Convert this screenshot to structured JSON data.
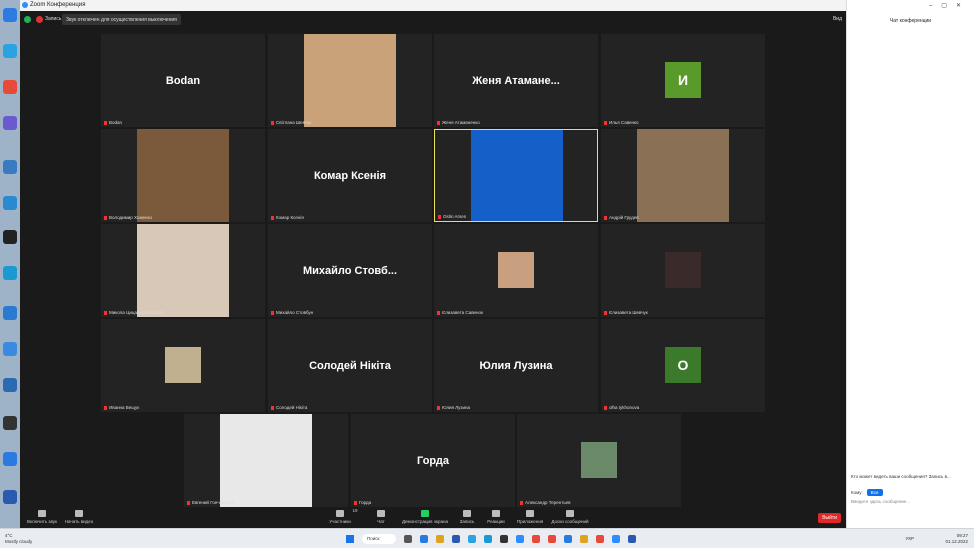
{
  "window": {
    "title": "Zoom Конференция"
  },
  "topbar": {
    "recording": "Запись",
    "tooltip": "Звук отключен для осуществления выключения",
    "view": "Вид"
  },
  "tiles": [
    {
      "name": "Bodan",
      "label": "Bodan",
      "kind": "text"
    },
    {
      "name": "Svitlana Shevchuk",
      "label": "Світлана Шевчук",
      "kind": "photo",
      "color": "#c9a27a"
    },
    {
      "name": "Женя Атамане...",
      "label": "Женя Атаманенко",
      "kind": "text"
    },
    {
      "name": "Ilya Savchenko",
      "label": "Илья Савенко",
      "kind": "avatar",
      "letter": "И",
      "color": "#5a9a2a"
    },
    {
      "name": "Volodymyr",
      "label": "Володимир Хоменко",
      "kind": "photo",
      "color": "#7a5a3a"
    },
    {
      "name": "Комар Ксенія",
      "label": "Комар Ксенія",
      "kind": "text"
    },
    {
      "name": "Ostin Arsen",
      "label": "Ostin Arsen",
      "kind": "blue",
      "color": "#1560c8"
    },
    {
      "name": "Andriy",
      "label": "Андрій Грудев",
      "kind": "photo",
      "color": "#8a7054"
    },
    {
      "name": "Mykola",
      "label": "Микола Цицарук (експерт)",
      "kind": "photo",
      "color": "#d8c8b8"
    },
    {
      "name": "Михайло Стовб...",
      "label": "Михайло Стовбун",
      "kind": "text"
    },
    {
      "name": "Yelyzaveta Savenok",
      "label": "Єлизавета Савенок",
      "kind": "smallphoto",
      "color": "#c8a080"
    },
    {
      "name": "Yelyzaveta Shevchuk",
      "label": "Єлизавета Шевчук",
      "kind": "smallphoto",
      "color": "#3a2a2a"
    },
    {
      "name": "Ivanna",
      "label": "Иванна Вещук",
      "kind": "smallphoto",
      "color": "#c0b090"
    },
    {
      "name": "Солодей Нікіта",
      "label": "Солодей Нікіта",
      "kind": "text"
    },
    {
      "name": "Юлия Лузина",
      "label": "Юлия Лузина",
      "kind": "text"
    },
    {
      "name": "olha",
      "label": "olha tykhonova",
      "kind": "avatar",
      "letter": "О",
      "color": "#3a7a2a"
    },
    {
      "name": "Yevhen",
      "label": "Евгений Гончаренко",
      "kind": "photo",
      "color": "#e8e8e8"
    },
    {
      "name": "Горда",
      "label": "Горда",
      "kind": "text"
    },
    {
      "name": "Oleksandr",
      "label": "Александр Терентьев",
      "kind": "smallphoto",
      "color": "#6a8a6a"
    }
  ],
  "toolbar": {
    "mute": "Включить звук",
    "video": "Начать видео",
    "participants": "Участники",
    "participants_count": "19",
    "chat": "Чат",
    "share": "Демонстрация экрана",
    "record": "Запись",
    "reactions": "Реакции",
    "apps": "Приложения",
    "whiteboard": "Доски сообщений",
    "leave": "Выйти"
  },
  "chat": {
    "title": "Чат конференции",
    "who_sees": "Кто может видеть ваши сообщения? Запись в...",
    "to_label": "Кому:",
    "to_value": "Все",
    "placeholder": "Введите здесь сообщение..."
  },
  "taskbar": {
    "temp": "4°C",
    "weather": "Mostly cloudy",
    "search": "Поиск",
    "lang": "УКР",
    "time": "09:27",
    "date": "01.12.2022"
  }
}
